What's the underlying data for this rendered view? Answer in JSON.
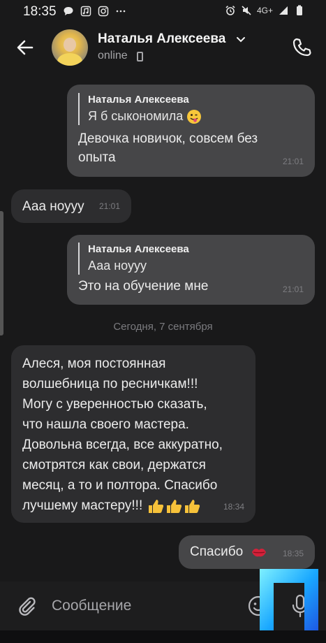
{
  "status_bar": {
    "time": "18:35",
    "network": "4G+",
    "icons_left": [
      "chat-bubble-icon",
      "music-icon",
      "instagram-icon",
      "more-dots-icon"
    ],
    "icons_right": [
      "alarm-icon",
      "mute-icon",
      "signal-icon",
      "battery-icon"
    ]
  },
  "header": {
    "contact_name": "Наталья Алексеева",
    "status": "online"
  },
  "messages": [
    {
      "direction": "out",
      "reply_name": "Наталья Алексеева",
      "reply_text": "Я б сыкономила",
      "text_line1": "Девочка новичок, совсем без",
      "text_line2": "опыта",
      "time": "21:01"
    },
    {
      "direction": "in",
      "text": "Ааа ноууу",
      "time": "21:01"
    },
    {
      "direction": "out",
      "reply_name": "Наталья Алексеева",
      "reply_text": "Ааа ноууу",
      "text": "Это на обучение мне",
      "time": "21:01"
    },
    {
      "direction": "in",
      "lines": [
        "Алеся, моя постоянная",
        "волшебница по ресничкам!!!",
        "Могу с уверенностью сказать,",
        "что нашла своего мастера.",
        "Довольна всегда, все аккуратно,",
        "смотрятся как свои, держатся",
        "месяц, а то и полтора. Спасибо",
        "лучшему мастеру!!!"
      ],
      "time": "18:34"
    },
    {
      "direction": "out",
      "text": "Спасибо",
      "time": "18:35"
    }
  ],
  "date_separator": "Сегодня, 7 сентября",
  "composer": {
    "placeholder": "Сообщение"
  }
}
